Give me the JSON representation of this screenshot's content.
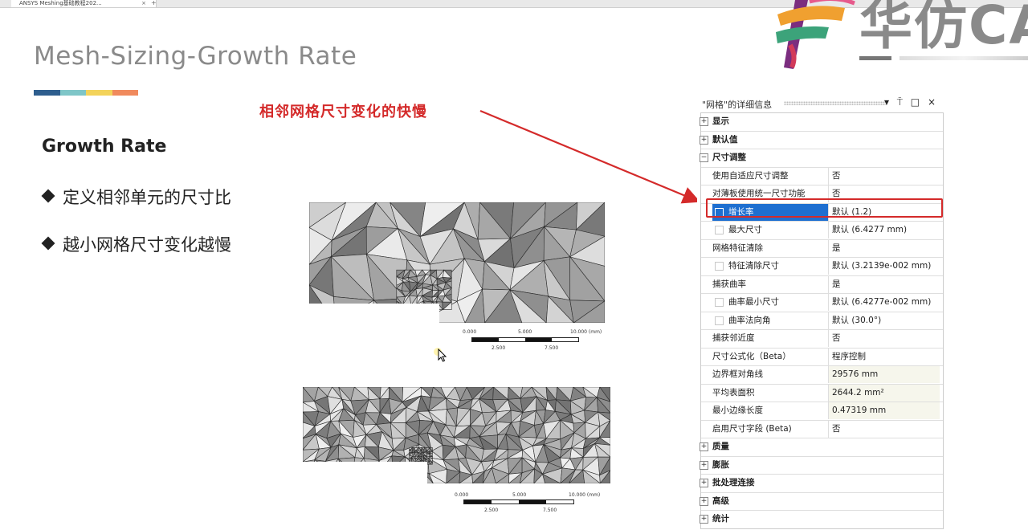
{
  "browser": {
    "tab_label": "ANSYS Meshing基础教程202...",
    "tab_close": "×",
    "new_tab": "+"
  },
  "slide": {
    "title": "Mesh-Sizing-Growth Rate",
    "accent_colors": [
      "#2e5e8e",
      "#7fc6c8",
      "#f3d35a",
      "#f08a5d"
    ],
    "heading": "Growth Rate",
    "bullets": [
      "定义相邻单元的尺寸比",
      "越小网格尺寸变化越慢"
    ],
    "annotation": "相邻网格尺寸变化的快慢",
    "annotation_color": "#d42a2a"
  },
  "logo": {
    "text": "华仿CA"
  },
  "mesh_figures": [
    {
      "scale_top": [
        "0.000",
        "5.000",
        "10.000 (mm)"
      ],
      "scale_bottom": [
        "2.500",
        "7.500"
      ]
    },
    {
      "scale_top": [
        "0.000",
        "5.000",
        "10.000 (mm)"
      ],
      "scale_bottom": [
        "2.500",
        "7.500"
      ]
    }
  ],
  "details_panel": {
    "title": "\"网格\"的详细信息",
    "controls": "▾ ⍑ □ ×",
    "groups_top": [
      {
        "label": "显示",
        "expander": "+"
      },
      {
        "label": "默认值",
        "expander": "+"
      },
      {
        "label": "尺寸调整",
        "expander": "−"
      }
    ],
    "properties": [
      {
        "label": "使用自适应尺寸调整",
        "value": "否"
      },
      {
        "label": "对薄板使用统一尺寸功能",
        "value": "否"
      },
      {
        "label": "增长率",
        "value": "默认 (1.2)"
      },
      {
        "label": "最大尺寸",
        "value": "默认 (6.4277 mm)"
      },
      {
        "label": "网格特征清除",
        "value": "是"
      },
      {
        "label": "特征清除尺寸",
        "value": "默认 (3.2139e-002 mm)"
      },
      {
        "label": "捕获曲率",
        "value": "是"
      },
      {
        "label": "曲率最小尺寸",
        "value": "默认 (6.4277e-002 mm)"
      },
      {
        "label": "曲率法向角",
        "value": "默认 (30.0°)"
      },
      {
        "label": "捕获邻近度",
        "value": "否"
      },
      {
        "label": "尺寸公式化（Beta）",
        "value": "程序控制"
      },
      {
        "label": "边界框对角线",
        "value": "29576 mm"
      },
      {
        "label": "平均表面积",
        "value": "2644.2 mm²"
      },
      {
        "label": "最小边缘长度",
        "value": "0.47319 mm"
      },
      {
        "label": "启用尺寸字段 (Beta)",
        "value": "否"
      }
    ],
    "groups_bottom": [
      {
        "label": "质量",
        "expander": "+"
      },
      {
        "label": "膨胀",
        "expander": "+"
      },
      {
        "label": "批处理连接",
        "expander": "+"
      },
      {
        "label": "高级",
        "expander": "+"
      },
      {
        "label": "统计",
        "expander": "+"
      }
    ],
    "selection_color": "#1e6fd0"
  }
}
